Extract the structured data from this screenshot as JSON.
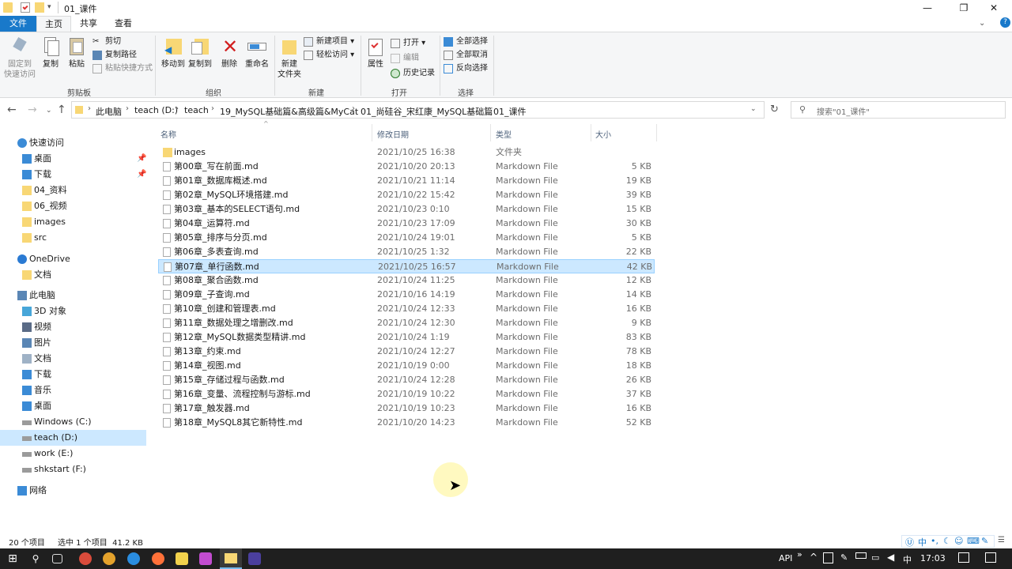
{
  "window": {
    "title": "01_课件",
    "minimize": "—",
    "maximize": "❐",
    "close": "✕"
  },
  "tabs": {
    "file": "文件",
    "home": "主页",
    "share": "共享",
    "view": "查看"
  },
  "ribbon": {
    "pin_quick_access": "固定到\n快速访问",
    "copy": "复制",
    "paste": "粘贴",
    "cut": "剪切",
    "copy_path": "复制路径",
    "paste_shortcut": "粘贴快捷方式",
    "clipboard_group": "剪贴板",
    "move_to": "移动到",
    "copy_to": "复制到",
    "delete": "删除",
    "rename": "重命名",
    "organize_group": "组织",
    "new_folder": "新建\n文件夹",
    "new_item": "新建项目",
    "easy_access": "轻松访问",
    "new_group": "新建",
    "properties": "属性",
    "open": "打开",
    "edit": "编辑",
    "history": "历史记录",
    "open_group": "打开",
    "select_all": "全部选择",
    "select_none": "全部取消",
    "invert_selection": "反向选择",
    "select_group": "选择"
  },
  "address": {
    "crumbs": [
      "此电脑",
      "teach (D:)",
      "teach",
      "19_MySQL基础篇&高级篇&MyCat",
      "01_尚硅谷_宋红康_MySQL基础篇",
      "01_课件"
    ],
    "search_placeholder": "搜索\"01_课件\""
  },
  "sidebar": {
    "items": [
      {
        "label": "快速访问",
        "icon": "star-icon"
      },
      {
        "label": "桌面",
        "icon": "desktop-icon",
        "pinned": true
      },
      {
        "label": "下载",
        "icon": "download-icon",
        "pinned": true
      },
      {
        "label": "04_资料",
        "icon": "folder-icon"
      },
      {
        "label": "06_视频",
        "icon": "folder-icon"
      },
      {
        "label": "images",
        "icon": "folder-icon"
      },
      {
        "label": "src",
        "icon": "folder-icon"
      },
      {
        "label": "OneDrive",
        "icon": "cloud-icon"
      },
      {
        "label": "文档",
        "icon": "folder-icon"
      },
      {
        "label": "此电脑",
        "icon": "computer-icon"
      },
      {
        "label": "3D 对象",
        "icon": "cube-icon"
      },
      {
        "label": "视频",
        "icon": "video-icon"
      },
      {
        "label": "图片",
        "icon": "picture-icon"
      },
      {
        "label": "文档",
        "icon": "document-icon"
      },
      {
        "label": "下载",
        "icon": "download-icon"
      },
      {
        "label": "音乐",
        "icon": "music-icon"
      },
      {
        "label": "桌面",
        "icon": "desktop-icon"
      },
      {
        "label": "Windows (C:)",
        "icon": "drive-icon"
      },
      {
        "label": "teach (D:)",
        "icon": "drive-icon"
      },
      {
        "label": "work (E:)",
        "icon": "drive-icon"
      },
      {
        "label": "shkstart (F:)",
        "icon": "drive-icon"
      },
      {
        "label": "网络",
        "icon": "network-icon"
      }
    ]
  },
  "columns": {
    "name": "名称",
    "modified": "修改日期",
    "type": "类型",
    "size": "大小"
  },
  "files": [
    {
      "name": "images",
      "modified": "2021/10/25 16:38",
      "type": "文件夹",
      "size": "",
      "folder": true
    },
    {
      "name": "第00章_写在前面.md",
      "modified": "2021/10/20 20:13",
      "type": "Markdown File",
      "size": "5 KB"
    },
    {
      "name": "第01章_数据库概述.md",
      "modified": "2021/10/21 11:14",
      "type": "Markdown File",
      "size": "19 KB"
    },
    {
      "name": "第02章_MySQL环境搭建.md",
      "modified": "2021/10/22 15:42",
      "type": "Markdown File",
      "size": "39 KB"
    },
    {
      "name": "第03章_基本的SELECT语句.md",
      "modified": "2021/10/23 0:10",
      "type": "Markdown File",
      "size": "15 KB"
    },
    {
      "name": "第04章_运算符.md",
      "modified": "2021/10/23 17:09",
      "type": "Markdown File",
      "size": "30 KB"
    },
    {
      "name": "第05章_排序与分页.md",
      "modified": "2021/10/24 19:01",
      "type": "Markdown File",
      "size": "5 KB"
    },
    {
      "name": "第06章_多表查询.md",
      "modified": "2021/10/25 1:32",
      "type": "Markdown File",
      "size": "22 KB"
    },
    {
      "name": "第07章_单行函数.md",
      "modified": "2021/10/25 16:57",
      "type": "Markdown File",
      "size": "42 KB",
      "selected": true
    },
    {
      "name": "第08章_聚合函数.md",
      "modified": "2021/10/24 11:25",
      "type": "Markdown File",
      "size": "12 KB"
    },
    {
      "name": "第09章_子查询.md",
      "modified": "2021/10/16 14:19",
      "type": "Markdown File",
      "size": "14 KB"
    },
    {
      "name": "第10章_创建和管理表.md",
      "modified": "2021/10/24 12:33",
      "type": "Markdown File",
      "size": "16 KB"
    },
    {
      "name": "第11章_数据处理之增删改.md",
      "modified": "2021/10/24 12:30",
      "type": "Markdown File",
      "size": "9 KB"
    },
    {
      "name": "第12章_MySQL数据类型精讲.md",
      "modified": "2021/10/24 1:19",
      "type": "Markdown File",
      "size": "83 KB"
    },
    {
      "name": "第13章_约束.md",
      "modified": "2021/10/24 12:27",
      "type": "Markdown File",
      "size": "78 KB"
    },
    {
      "name": "第14章_视图.md",
      "modified": "2021/10/19 0:00",
      "type": "Markdown File",
      "size": "18 KB"
    },
    {
      "name": "第15章_存储过程与函数.md",
      "modified": "2021/10/24 12:28",
      "type": "Markdown File",
      "size": "26 KB"
    },
    {
      "name": "第16章_变量、流程控制与游标.md",
      "modified": "2021/10/19 10:22",
      "type": "Markdown File",
      "size": "37 KB"
    },
    {
      "name": "第17章_触发器.md",
      "modified": "2021/10/19 10:23",
      "type": "Markdown File",
      "size": "16 KB"
    },
    {
      "name": "第18章_MySQL8其它新特性.md",
      "modified": "2021/10/20 14:23",
      "type": "Markdown File",
      "size": "52 KB"
    }
  ],
  "status": {
    "count": "20 个项目",
    "selection": "选中 1 个项目  41.2 KB"
  },
  "taskbar": {
    "api": "API",
    "ime_label": "中",
    "time": "17:03",
    "tray_ime": "中"
  },
  "colors": {
    "accent": "#1979ca",
    "selection": "#cce8ff",
    "selection_border": "#99d1ff",
    "folder": "#f8d775"
  }
}
